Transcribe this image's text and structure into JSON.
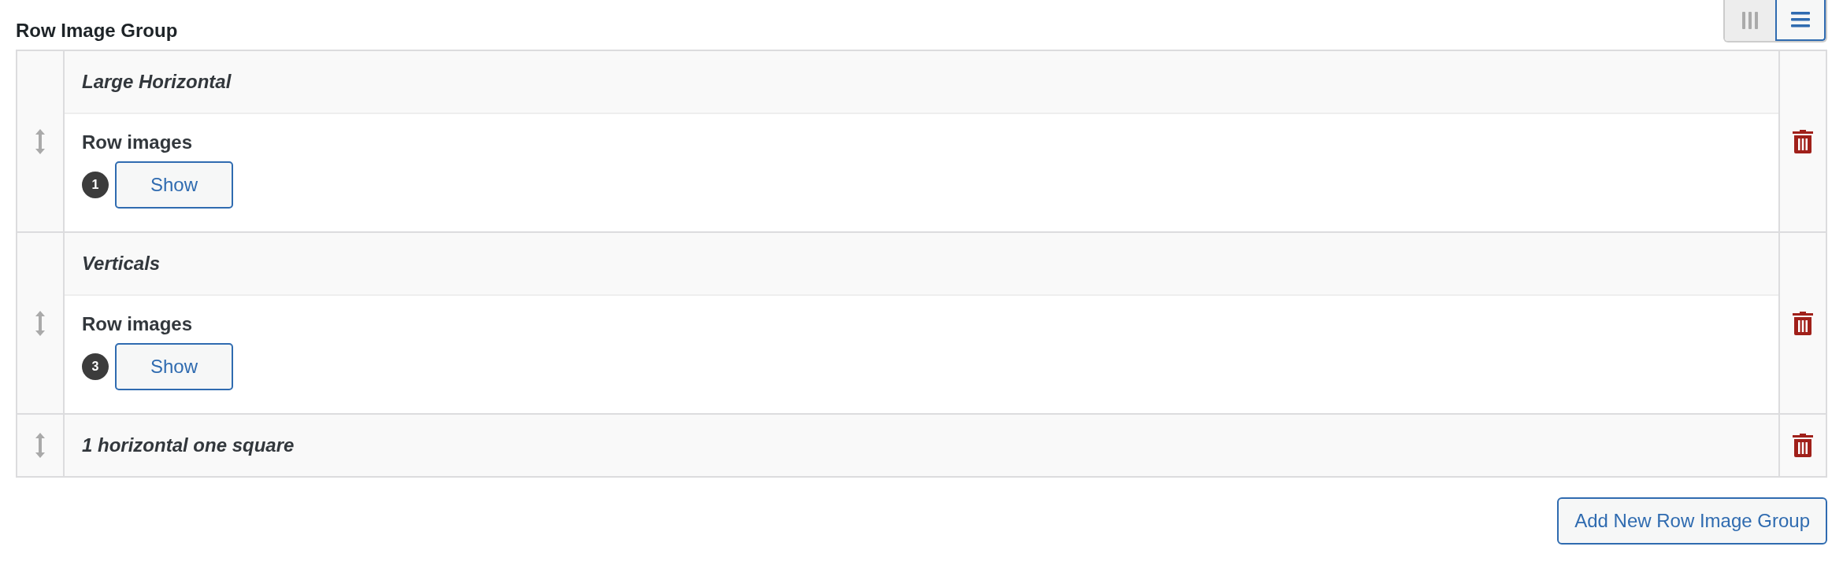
{
  "title": "Row Image Group",
  "layout_toggle": [
    {
      "kind": "columns",
      "selected": false
    },
    {
      "kind": "rows",
      "selected": true
    }
  ],
  "rows": [
    {
      "title": "Large Horizontal",
      "expanded": true,
      "field_label": "Row images",
      "count": "1",
      "button": "Show"
    },
    {
      "title": "Verticals",
      "expanded": true,
      "field_label": "Row images",
      "count": "3",
      "button": "Show"
    },
    {
      "title": "1 horizontal one square",
      "expanded": false
    }
  ],
  "add_button": "Add New Row Image Group"
}
